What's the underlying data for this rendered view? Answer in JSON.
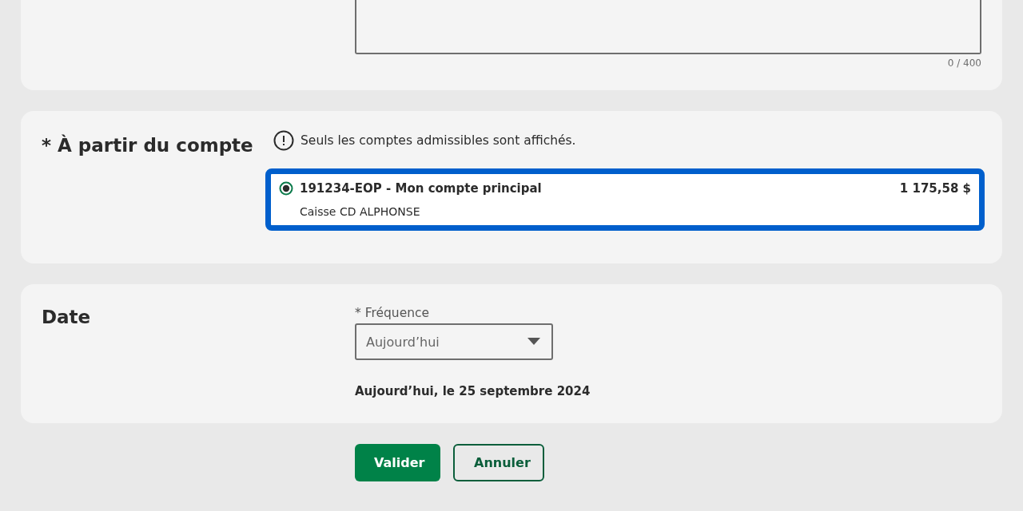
{
  "message_section": {
    "counter": "0 / 400"
  },
  "account_section": {
    "title": "* À partir du compte",
    "info": "Seuls les comptes admissibles sont affichés.",
    "accounts": [
      {
        "name": "191234-EOP - Mon compte principal",
        "institution": "Caisse CD ALPHONSE",
        "balance": "1 175,58 $",
        "selected": true,
        "focused": true
      }
    ]
  },
  "date_section": {
    "title": "Date",
    "frequency_label": "* Fréquence",
    "frequency_value": "Aujourd’hui",
    "date_text": "Aujourd’hui, le 25 septembre 2024"
  },
  "buttons": [
    {
      "label": "Valider",
      "kind": "primary"
    },
    {
      "label": "Annuler",
      "kind": "secondary"
    }
  ]
}
